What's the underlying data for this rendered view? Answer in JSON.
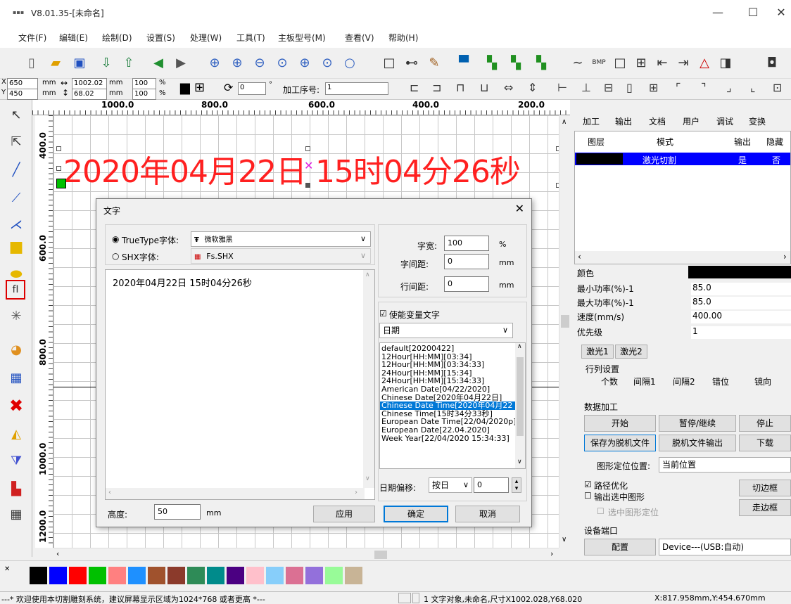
{
  "window": {
    "logo": "▪▪▪",
    "title": "V8.01.35-[未命名]",
    "min": "—",
    "max": "☐",
    "close": "✕"
  },
  "menu": [
    "文件(F)",
    "编辑(E)",
    "绘制(D)",
    "设置(S)",
    "处理(W)",
    "工具(T)",
    "主板型号(M)",
    "查看(V)",
    "帮助(H)"
  ],
  "toolbar2": {
    "x_label": "X",
    "x_value": "650",
    "y_label": "Y",
    "y_value": "450",
    "unit": "mm",
    "w_value": "1002.02",
    "h_value": "68.02",
    "pct_w": "100",
    "pct_h": "100",
    "pct": "%",
    "rotate": "0",
    "deg": "°",
    "seq_label": "加工序号:",
    "seq_value": "1"
  },
  "ruler": {
    "h_labels": [
      "1000.0",
      "800.0",
      "600.0",
      "400.0",
      "200.0"
    ],
    "v_labels": [
      "400.0",
      "600.0",
      "800.0",
      "1000.0",
      "1200.0"
    ]
  },
  "canvas": {
    "text": "2020年04月22日 15时04分26秒"
  },
  "right_panel": {
    "tabs": [
      "加工",
      "输出",
      "文档",
      "用户",
      "调试",
      "变换"
    ],
    "layer_headers": [
      "图层",
      "模式",
      "输出",
      "隐藏"
    ],
    "layer_row": {
      "mode": "激光切割",
      "output": "是",
      "hidden": "否"
    },
    "properties": [
      {
        "label": "颜色",
        "value": ""
      },
      {
        "label": "最小功率(%)-1",
        "value": "85.0"
      },
      {
        "label": "最大功率(%)-1",
        "value": "85.0"
      },
      {
        "label": "速度(mm/s)",
        "value": "400.00"
      },
      {
        "label": "优先级",
        "value": "1"
      }
    ],
    "laser_tabs": [
      "激光1",
      "激光2"
    ],
    "array_title": "行列设置",
    "array_headers": [
      "个数",
      "间隔1",
      "间隔2",
      "错位",
      "镜向"
    ],
    "data_title": "数据加工",
    "start": "开始",
    "pause": "暂停/继续",
    "stop": "停止",
    "save_offline": "保存为脱机文件",
    "offline_out": "脱机文件输出",
    "download": "下载",
    "pos_label": "图形定位位置:",
    "pos_value": "当前位置",
    "path_opt": "路径优化",
    "output_selected": "输出选中图形",
    "selected_pos": "选中图形定位",
    "cut_frame": "切边框",
    "walk_frame": "走边框",
    "device_title": "设备端口",
    "config": "配置",
    "device_value": "Device---(USB:自动)"
  },
  "colors": [
    "#000000",
    "#0000ff",
    "#ff0000",
    "#00c000",
    "#ff8080",
    "#1e90ff",
    "#a0522d",
    "#8b3a2b",
    "#2e8b57",
    "#008b8b",
    "#4b0082",
    "#ffc0cb",
    "#87cefa",
    "#db7093",
    "#9370db",
    "#98fb98",
    "#c8b496"
  ],
  "status": {
    "welcome": "---* 欢迎使用本切割雕刻系统，建议屏幕显示区域为1024*768 或者更高 *---",
    "object_info": "1 文字对象,未命名,尺寸X1002.028,Y68.020",
    "coords": "X:817.958mm,Y:454.670mm"
  },
  "dialog": {
    "title": "文字",
    "close": "✕",
    "truetype_label": "TrueType字体:",
    "truetype_value": "微软雅黑",
    "shx_label": "SHX字体:",
    "shx_value": "Fs.SHX",
    "text_content": "2020年04月22日  15时04分26秒",
    "char_width_label": "字宽:",
    "char_width_value": "100",
    "char_width_unit": "%",
    "char_spacing_label": "字间距:",
    "char_spacing_value": "0",
    "line_spacing_label": "行间距:",
    "line_spacing_value": "0",
    "unit_mm": "mm",
    "variable_label": "使能变量文字",
    "variable_type": "日期",
    "formats": [
      "default[20200422]",
      "12Hour[HH:MM][03:34]",
      "12Hour[HH:MM][03:34:33]",
      "24Hour[HH:MM][15:34]",
      "24Hour[HH:MM][15:34:33]",
      "American Date[04/22/2020]",
      "Chinese Date[2020年04月22日]",
      "Chinese Date Time[2020年04月22",
      "Chinese Time[15时34分33秒]",
      "European Date Time[22/04/2020p]",
      "European Date[22.04.2020]",
      "Week Year[22/04/2020 15:34:33]"
    ],
    "selected_index": 7,
    "offset_label": "日期偏移:",
    "offset_unit": "按日",
    "offset_value": "0",
    "height_label": "高度:",
    "height_value": "50",
    "height_unit": "mm",
    "apply": "应用",
    "ok": "确定",
    "cancel": "取消"
  }
}
